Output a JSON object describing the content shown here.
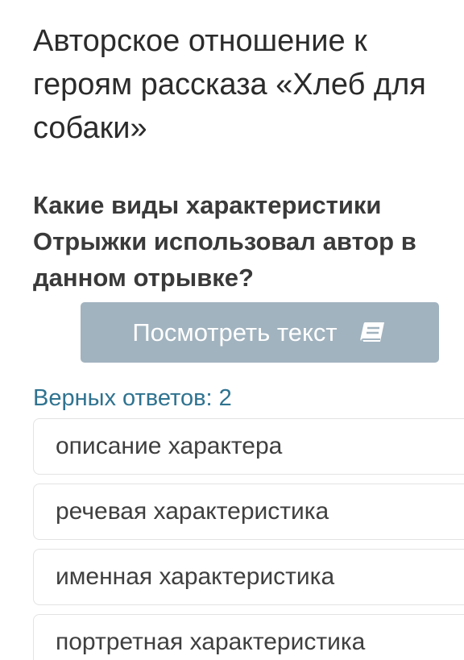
{
  "page": {
    "title": "Авторское отношение к героям рассказа «Хлеб для собаки»"
  },
  "question": {
    "lines": [
      "Какие виды характеристики",
      "Отрыжки использовал автор в",
      "данном отрывке?"
    ]
  },
  "view_button": {
    "label": "Посмотреть текст",
    "icon": "book-icon"
  },
  "answers": {
    "count_label": "Верных ответов: 2"
  },
  "options": [
    "описание характера",
    "речевая характеристика",
    "именная характеристика",
    "портретная характеристика"
  ],
  "colors": {
    "button_bg": "#a1b3bf",
    "count_text": "#2f7390",
    "option_border": "#e3e3e3"
  }
}
